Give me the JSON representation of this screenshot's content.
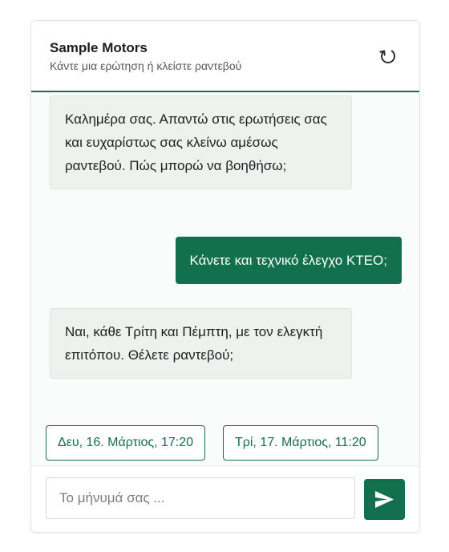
{
  "header": {
    "title": "Sample Motors",
    "subtitle": "Κάντε μια ερώτηση ή κλείστε ραντεβού",
    "refresh_icon": "refresh-icon"
  },
  "messages": [
    {
      "role": "bot",
      "text": "Καλημέρα σας. Απαντώ στις ερωτήσεις σας και ευχαρίστως σας κλείνω αμέσως ραντεβού. Πώς μπορώ να βοηθήσω;"
    },
    {
      "role": "user",
      "text": "Κάνετε και τεχνικό έλεγχο ΚΤΕΟ;"
    },
    {
      "role": "bot",
      "text": "Ναι, κάθε Τρίτη και Πέμπτη, με τον ελεγκτή επιτόπου. Θέλετε ραντεβού;"
    }
  ],
  "suggestions": [
    {
      "label": "Δευ, 16. Μάρτιος, 17:20"
    },
    {
      "label": "Τρί, 17. Μάρτιος, 11:20"
    }
  ],
  "composer": {
    "placeholder": "Το μήνυμά σας ...",
    "value": "",
    "send_icon": "send-icon"
  },
  "colors": {
    "accent": "#12704f",
    "bot_bubble": "#edf2ef",
    "user_text": "#ffffff"
  }
}
